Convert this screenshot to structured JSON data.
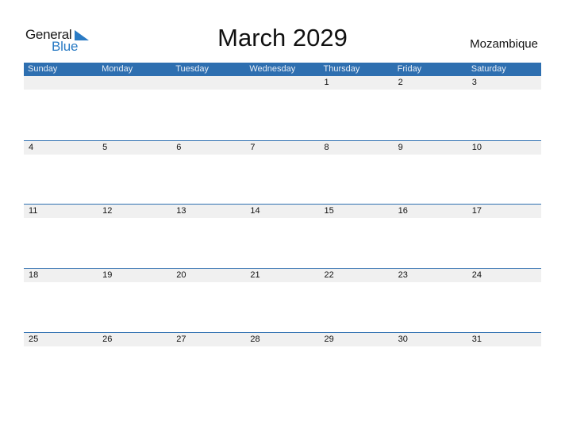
{
  "logo": {
    "word1": "General",
    "word2": "Blue",
    "accent": "#2a7bc4"
  },
  "title": "March 2029",
  "country": "Mozambique",
  "colors": {
    "header_bg": "#2e6fb0",
    "strip_bg": "#f0f0f0"
  },
  "weekdays": [
    "Sunday",
    "Monday",
    "Tuesday",
    "Wednesday",
    "Thursday",
    "Friday",
    "Saturday"
  ],
  "weeks": [
    [
      "",
      "",
      "",
      "",
      "1",
      "2",
      "3"
    ],
    [
      "4",
      "5",
      "6",
      "7",
      "8",
      "9",
      "10"
    ],
    [
      "11",
      "12",
      "13",
      "14",
      "15",
      "16",
      "17"
    ],
    [
      "18",
      "19",
      "20",
      "21",
      "22",
      "23",
      "24"
    ],
    [
      "25",
      "26",
      "27",
      "28",
      "29",
      "30",
      "31"
    ]
  ]
}
